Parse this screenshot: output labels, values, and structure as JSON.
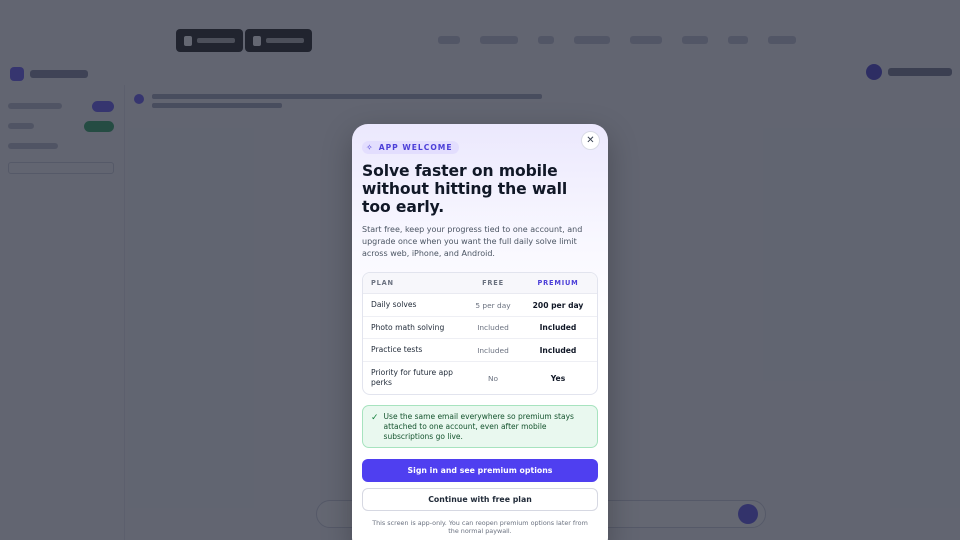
{
  "modal": {
    "badge": "APP WELCOME",
    "close_label": "✕",
    "title": "Solve faster on mobile without hitting the wall too early.",
    "description": "Start free, keep your progress tied to one account, and upgrade once when you want the full daily solve limit across web, iPhone, and Android.",
    "table": {
      "headers": [
        "PLAN",
        "FREE",
        "PREMIUM"
      ],
      "rows": [
        {
          "feature": "Daily solves",
          "free": "5 per day",
          "premium": "200 per day"
        },
        {
          "feature": "Photo math solving",
          "free": "Included",
          "premium": "Included"
        },
        {
          "feature": "Practice tests",
          "free": "Included",
          "premium": "Included"
        },
        {
          "feature": "Priority for future app perks",
          "free": "No",
          "premium": "Yes"
        }
      ]
    },
    "note": "Use the same email everywhere so premium stays attached to one account, even after mobile subscriptions go live.",
    "primary_button": "Sign in and see premium options",
    "secondary_button": "Continue with free plan",
    "footer": "This screen is app-only. You can reopen premium options later from the normal paywall."
  },
  "colors": {
    "accent": "#4f3ff0",
    "badge_text": "#4c3fd8",
    "note_bg": "#e9f8ef",
    "note_border": "#a7e3bf",
    "overlay": "rgba(40,44,60,0.72)"
  },
  "icons": {
    "badge": "sparkle-icon",
    "close": "close-icon",
    "note": "check-icon"
  }
}
